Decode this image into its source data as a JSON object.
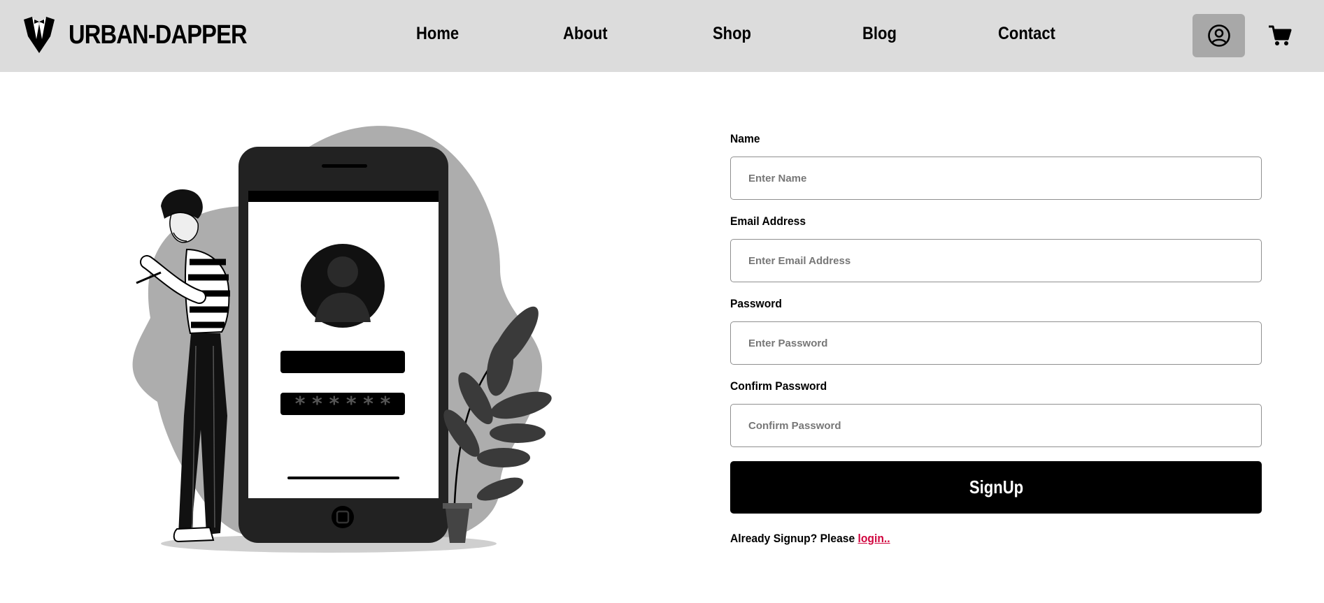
{
  "brand": {
    "name": "URBAN-DAPPER",
    "logo_icon": "tuxedo-icon"
  },
  "nav": {
    "links": [
      {
        "label": "Home"
      },
      {
        "label": "About"
      },
      {
        "label": "Shop"
      },
      {
        "label": "Blog"
      },
      {
        "label": "Contact"
      }
    ],
    "account_icon": "user-circle-icon",
    "cart_icon": "cart-icon"
  },
  "illustration": {
    "subject": "person-with-phone-login-illustration",
    "password_mask": "* * * * * *"
  },
  "form": {
    "fields": [
      {
        "label": "Name",
        "placeholder": "Enter Name",
        "value": ""
      },
      {
        "label": "Email Address",
        "placeholder": "Enter Email Address",
        "value": ""
      },
      {
        "label": "Password",
        "placeholder": "Enter Password",
        "value": ""
      },
      {
        "label": "Confirm Password",
        "placeholder": "Confirm Password",
        "value": ""
      }
    ],
    "submit_label": "SignUp",
    "login_prompt_prefix": "Already Signup",
    "login_prompt_mid": "? Please ",
    "login_link": "login.."
  },
  "colors": {
    "navbar_bg": "#dcdcdc",
    "account_btn_bg": "#a8a8a8",
    "button_bg": "#000000",
    "link": "#d1063f"
  }
}
